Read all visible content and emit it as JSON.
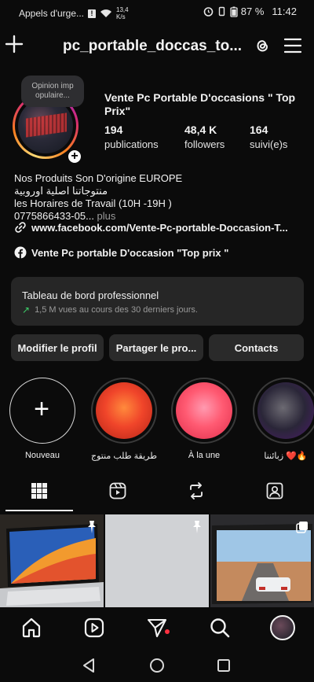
{
  "status_bar": {
    "carrier": "Appels d'urge...",
    "speed_top": "13,4",
    "speed_unit": "K/s",
    "battery": "87 %",
    "time": "11:42"
  },
  "top_bar": {
    "username": "pc_portable_doccas_to..."
  },
  "profile": {
    "note": "Opinion imp opulaire...",
    "full_name": "Vente Pc Portable D'occasions \" Top Prix\"",
    "stats": [
      {
        "value": "194",
        "label": "publications"
      },
      {
        "value": "48,4 K",
        "label": "followers"
      },
      {
        "value": "164",
        "label": "suivi(e)s"
      }
    ],
    "bio": {
      "line1": "Nos Produits Son D'origine EUROPE",
      "line2": "منتوجاتنا اصلية اوروبية",
      "line3": "les Horaires de Travail (10H -19H )",
      "line4": "0775866433-05...",
      "more": " plus"
    },
    "link": "www.facebook.com/Vente-Pc-portable-Doccasion-T...",
    "facebook_page": "Vente Pc portable D'occasion \"Top prix \""
  },
  "dashboard": {
    "title": "Tableau de bord professionnel",
    "subtitle": "1,5 M vues au cours des 30 derniers jours."
  },
  "buttons": {
    "edit": "Modifier le profil",
    "share": "Partager le pro...",
    "contacts": "Contacts"
  },
  "highlights": [
    {
      "label": "Nouveau"
    },
    {
      "label": "طريقة طلب منتوج"
    },
    {
      "label": "À la une"
    },
    {
      "label": "زبائننا ❤️🔥"
    }
  ],
  "colors": {
    "background": "#0b0b0b",
    "surface": "#262626",
    "button": "#2a2a2a",
    "trend_green": "#3ecf6a",
    "notification_red": "#ff3040"
  }
}
